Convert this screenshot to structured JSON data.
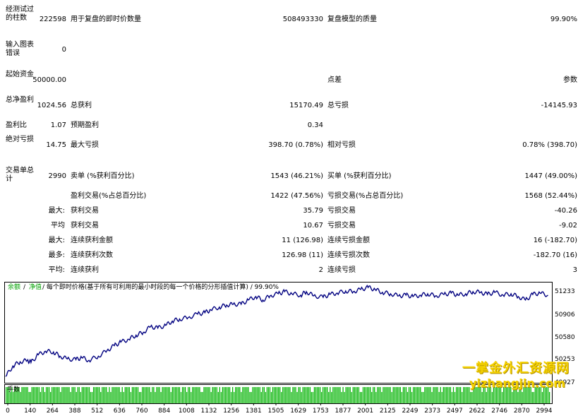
{
  "report": {
    "bars_label": "经测试过的柱数",
    "bars_value": "222598",
    "ticks_label": "用于复盘的即时价数量",
    "ticks_value": "508493330",
    "quality_label": "复盘模型的质量",
    "quality_value": "99.90%",
    "mismatch_label": "输入图表错误",
    "mismatch_value": "0",
    "deposit_label": "起始资金",
    "deposit_value": "50000.00",
    "spread_label": "点差",
    "spread_value": "参数",
    "net_label": "总净盈利",
    "net_value": "1024.56",
    "gross_profit_label": "总获利",
    "gross_profit_value": "15170.49",
    "gross_loss_label": "总亏损",
    "gross_loss_value": "-14145.93",
    "pf_label": "盈利比",
    "pf_value": "1.07",
    "payoff_label": "预期盈利",
    "payoff_value": "0.34",
    "abs_dd_label": "绝对亏损",
    "abs_dd_value": "14.75",
    "max_dd_label": "最大亏损",
    "max_dd_value": "398.70 (0.78%)",
    "rel_dd_label": "相对亏损",
    "rel_dd_value": "0.78% (398.70)",
    "total_trades_label": "交易单总计",
    "total_trades_value": "2990",
    "short_label": "卖单 (%获利百分比)",
    "short_value": "1543 (46.21%)",
    "long_label": "买单 (%获利百分比)",
    "long_value": "1447 (49.00%)",
    "profit_trades_label": "盈利交易(%占总百分比)",
    "profit_trades_value": "1422 (47.56%)",
    "loss_trades_label": "亏损交易(%占总百分比)",
    "loss_trades_value": "1568 (52.44%)",
    "largest_label": "最大:",
    "largest_profit_label": "获利交易",
    "largest_profit_value": "35.79",
    "largest_loss_label": "亏损交易",
    "largest_loss_value": "-40.26",
    "average_label": "平均",
    "average_profit_label": "获利交易",
    "average_profit_value": "10.67",
    "average_loss_label": "亏损交易",
    "average_loss_value": "-9.02",
    "max_consec_label": "最大:",
    "max_consec_wins_label": "连续获利金额",
    "max_consec_wins_value": "11 (126.98)",
    "max_consec_losses_label": "连续亏损金额",
    "max_consec_losses_value": "16 (-182.70)",
    "max_consec2_label": "最多:",
    "max_consec_profit_label": "连续获利次数",
    "max_consec_profit_value": "126.98 (11)",
    "max_consec_loss_label": "连续亏损次数",
    "max_consec_loss_value": "-182.70 (16)",
    "avg_consec_label": "平均:",
    "avg_consec_wins_label": "连续获利",
    "avg_consec_wins_value": "2",
    "avg_consec_losses_label": "连续亏损",
    "avg_consec_losses_value": "3"
  },
  "chart_data": {
    "type": "line",
    "legend": {
      "balance": "余额",
      "sep1": "/",
      "equity": "净值",
      "desc": "/ 每个即时价格(基于所有可利用的最小时段的每一个价格的分形插值计算) / 99.90%"
    },
    "lot_label": "手数",
    "y_ticks": [
      "51233",
      "50906",
      "50580",
      "50253",
      "49927"
    ],
    "ylim": [
      49900,
      51300
    ],
    "x_ticks": [
      "0",
      "140",
      "264",
      "388",
      "512",
      "636",
      "760",
      "884",
      "1008",
      "1132",
      "1256",
      "1381",
      "1505",
      "1629",
      "1753",
      "1877",
      "2001",
      "2125",
      "2249",
      "2373",
      "2497",
      "2622",
      "2746",
      "2870",
      "2994"
    ],
    "xlim": [
      0,
      3000
    ],
    "series": [
      {
        "x": [
          0,
          40,
          80,
          120,
          140,
          180,
          220,
          264,
          300,
          340,
          388,
          420,
          460,
          512,
          560,
          600,
          636,
          680,
          720,
          760,
          800,
          840,
          884,
          920,
          960,
          1008,
          1060,
          1100,
          1132,
          1180,
          1220,
          1256,
          1300,
          1340,
          1381,
          1420,
          1460,
          1505,
          1540,
          1580,
          1629,
          1660,
          1700,
          1753,
          1790,
          1830,
          1877,
          1920,
          1960,
          2001,
          2040,
          2080,
          2125,
          2170,
          2210,
          2249,
          2290,
          2330,
          2373,
          2420,
          2460,
          2497,
          2540,
          2580,
          2622,
          2660,
          2700,
          2746,
          2790,
          2830,
          2870,
          2910,
          2950,
          2994
        ],
        "values": [
          49970,
          50120,
          50180,
          50200,
          50170,
          50280,
          50330,
          50320,
          50260,
          50220,
          50210,
          50240,
          50200,
          50260,
          50340,
          50410,
          50460,
          50500,
          50560,
          50600,
          50680,
          50660,
          50700,
          50760,
          50790,
          50810,
          50860,
          50880,
          50920,
          50960,
          50990,
          51000,
          51000,
          51060,
          51110,
          51060,
          51120,
          51150,
          51180,
          51150,
          51130,
          51180,
          51120,
          51100,
          51140,
          51160,
          51190,
          51180,
          51210,
          51240,
          51210,
          51170,
          51150,
          51120,
          51130,
          51110,
          51130,
          51150,
          51120,
          51140,
          51160,
          51130,
          51150,
          51180,
          51170,
          51140,
          51170,
          51130,
          51150,
          51110,
          51060,
          51140,
          51160,
          51130
        ]
      }
    ],
    "lots_value": 0.1,
    "colors": {
      "balance": "#000080",
      "bars": "#00b300",
      "legend_green": "#00a000"
    }
  }
}
